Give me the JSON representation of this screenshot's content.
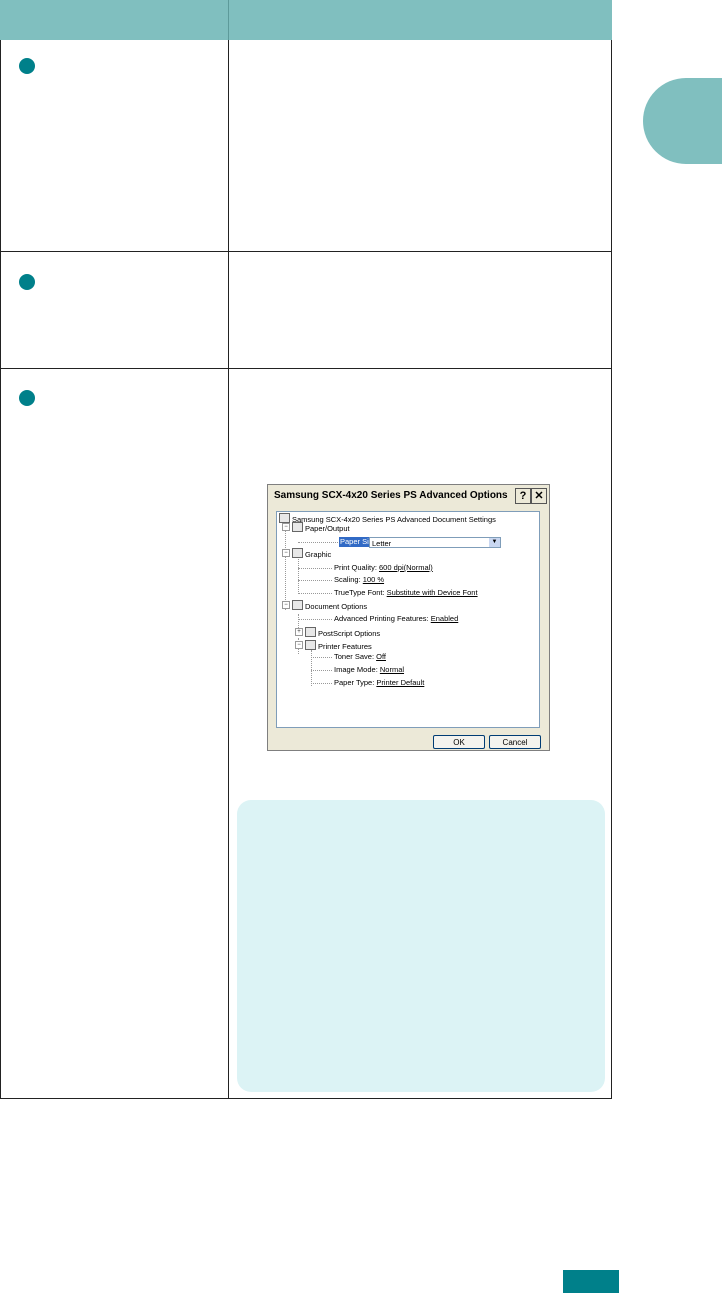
{
  "table": {
    "header_col1": "",
    "header_col2": "",
    "rows": [
      {
        "marker": ""
      },
      {
        "marker": ""
      },
      {
        "marker": ""
      }
    ]
  },
  "chapter_tab": "",
  "dialog": {
    "title": "Samsung SCX-4x20 Series PS Advanced Options",
    "help_btn": "?",
    "close_btn": "✕",
    "tree": {
      "root": "Samsung SCX-4x20 Series PS Advanced Document Settings",
      "paper_output": "Paper/Output",
      "paper_size_label": "Paper Size:",
      "paper_size_value": "Letter",
      "graphic": "Graphic",
      "print_quality_label": "Print Quality: ",
      "print_quality_value": "600 dpi(Normal)",
      "scaling_label": "Scaling: ",
      "scaling_value": "100 %",
      "truetype_label": "TrueType Font: ",
      "truetype_value": "Substitute with Device Font",
      "document_options": "Document Options",
      "adv_printing_label": "Advanced Printing Features: ",
      "adv_printing_value": "Enabled",
      "postscript_options": "PostScript Options",
      "printer_features": "Printer Features",
      "toner_save_label": "Toner Save: ",
      "toner_save_value": "Off",
      "image_mode_label": "Image Mode: ",
      "image_mode_value": "Normal",
      "paper_type_label": "Paper Type: ",
      "paper_type_value": "Printer Default"
    },
    "ok": "OK",
    "cancel": "Cancel"
  },
  "note": "",
  "page_number": ""
}
